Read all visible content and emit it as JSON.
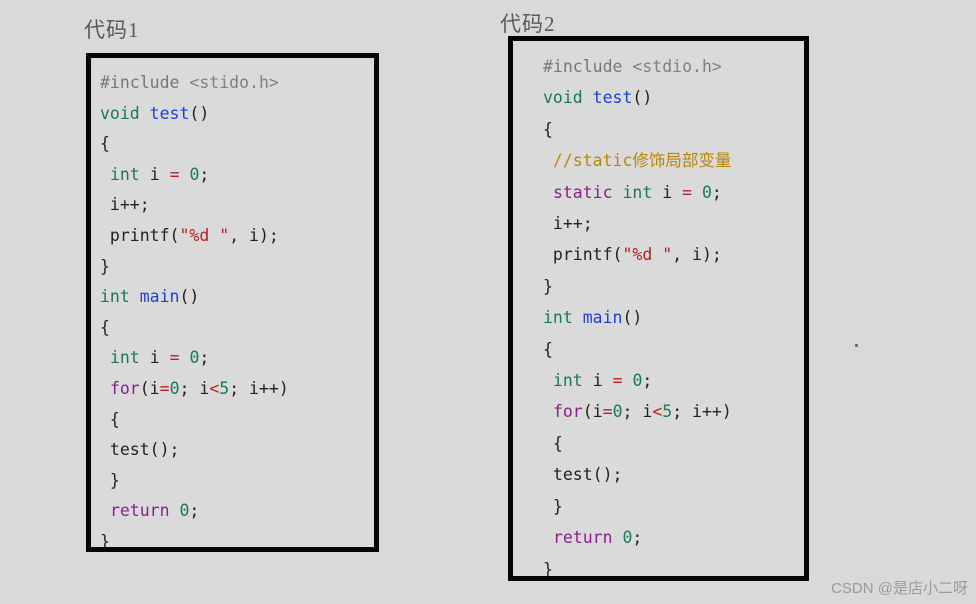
{
  "background_color": "#d9d9d9",
  "panels": [
    {
      "title": "代码1",
      "box_background": "#dadada",
      "border_color": "#060606",
      "lines": [
        [
          {
            "t": "#include ",
            "c": "tok-pre"
          },
          {
            "t": "<stido.h>",
            "c": "tok-header"
          }
        ],
        [
          {
            "t": "void ",
            "c": "tok-type"
          },
          {
            "t": "test",
            "c": "tok-fn"
          },
          {
            "t": "()",
            "c": "tok-plain"
          }
        ],
        [
          {
            "t": "{",
            "c": "tok-plain"
          }
        ],
        [
          {
            "t": " ",
            "c": "tok-plain"
          },
          {
            "t": "int ",
            "c": "tok-type"
          },
          {
            "t": "i ",
            "c": "tok-plain"
          },
          {
            "t": "=",
            "c": "tok-op"
          },
          {
            "t": " ",
            "c": "tok-plain"
          },
          {
            "t": "0",
            "c": "tok-num"
          },
          {
            "t": ";",
            "c": "tok-plain"
          }
        ],
        [
          {
            "t": " i++;",
            "c": "tok-plain"
          }
        ],
        [
          {
            "t": " printf(",
            "c": "tok-plain"
          },
          {
            "t": "\"%d \"",
            "c": "tok-str"
          },
          {
            "t": ", i);",
            "c": "tok-plain"
          }
        ],
        [
          {
            "t": "}",
            "c": "tok-plain"
          }
        ],
        [
          {
            "t": "int ",
            "c": "tok-type"
          },
          {
            "t": "main",
            "c": "tok-fn"
          },
          {
            "t": "()",
            "c": "tok-plain"
          }
        ],
        [
          {
            "t": "{",
            "c": "tok-plain"
          }
        ],
        [
          {
            "t": " ",
            "c": "tok-plain"
          },
          {
            "t": "int ",
            "c": "tok-type"
          },
          {
            "t": "i ",
            "c": "tok-plain"
          },
          {
            "t": "=",
            "c": "tok-op"
          },
          {
            "t": " ",
            "c": "tok-plain"
          },
          {
            "t": "0",
            "c": "tok-num"
          },
          {
            "t": ";",
            "c": "tok-plain"
          }
        ],
        [
          {
            "t": " ",
            "c": "tok-plain"
          },
          {
            "t": "for",
            "c": "tok-kw"
          },
          {
            "t": "(i",
            "c": "tok-plain"
          },
          {
            "t": "=",
            "c": "tok-op"
          },
          {
            "t": "0",
            "c": "tok-num"
          },
          {
            "t": "; i",
            "c": "tok-plain"
          },
          {
            "t": "<",
            "c": "tok-op"
          },
          {
            "t": "5",
            "c": "tok-num"
          },
          {
            "t": "; i++)",
            "c": "tok-plain"
          }
        ],
        [
          {
            "t": " {",
            "c": "tok-plain"
          }
        ],
        [
          {
            "t": " test();",
            "c": "tok-plain"
          }
        ],
        [
          {
            "t": " }",
            "c": "tok-plain"
          }
        ],
        [
          {
            "t": " ",
            "c": "tok-plain"
          },
          {
            "t": "return",
            "c": "tok-kw"
          },
          {
            "t": " ",
            "c": "tok-plain"
          },
          {
            "t": "0",
            "c": "tok-num"
          },
          {
            "t": ";",
            "c": "tok-plain"
          }
        ],
        [
          {
            "t": "}",
            "c": "tok-plain"
          }
        ]
      ]
    },
    {
      "title": "代码2",
      "box_background": "#dadada",
      "border_color": "#060606",
      "lines": [
        [
          {
            "t": "#include ",
            "c": "tok-pre"
          },
          {
            "t": "<stdio.h>",
            "c": "tok-header"
          }
        ],
        [
          {
            "t": "void ",
            "c": "tok-type"
          },
          {
            "t": "test",
            "c": "tok-fn"
          },
          {
            "t": "()",
            "c": "tok-plain"
          }
        ],
        [
          {
            "t": "{",
            "c": "tok-plain"
          }
        ],
        [
          {
            "t": " //static修饰局部变量",
            "c": "tok-comment"
          }
        ],
        [
          {
            "t": " ",
            "c": "tok-plain"
          },
          {
            "t": "static ",
            "c": "tok-kw"
          },
          {
            "t": "int ",
            "c": "tok-type"
          },
          {
            "t": "i ",
            "c": "tok-plain"
          },
          {
            "t": "=",
            "c": "tok-op"
          },
          {
            "t": " ",
            "c": "tok-plain"
          },
          {
            "t": "0",
            "c": "tok-num"
          },
          {
            "t": ";",
            "c": "tok-plain"
          }
        ],
        [
          {
            "t": " i++;",
            "c": "tok-plain"
          }
        ],
        [
          {
            "t": " printf(",
            "c": "tok-plain"
          },
          {
            "t": "\"%d \"",
            "c": "tok-str"
          },
          {
            "t": ", i);",
            "c": "tok-plain"
          }
        ],
        [
          {
            "t": "}",
            "c": "tok-plain"
          }
        ],
        [
          {
            "t": "int ",
            "c": "tok-type"
          },
          {
            "t": "main",
            "c": "tok-fn"
          },
          {
            "t": "()",
            "c": "tok-plain"
          }
        ],
        [
          {
            "t": "{",
            "c": "tok-plain"
          }
        ],
        [
          {
            "t": " ",
            "c": "tok-plain"
          },
          {
            "t": "int ",
            "c": "tok-type"
          },
          {
            "t": "i ",
            "c": "tok-plain"
          },
          {
            "t": "=",
            "c": "tok-op"
          },
          {
            "t": " ",
            "c": "tok-plain"
          },
          {
            "t": "0",
            "c": "tok-num"
          },
          {
            "t": ";",
            "c": "tok-plain"
          }
        ],
        [
          {
            "t": " ",
            "c": "tok-plain"
          },
          {
            "t": "for",
            "c": "tok-kw"
          },
          {
            "t": "(i",
            "c": "tok-plain"
          },
          {
            "t": "=",
            "c": "tok-op"
          },
          {
            "t": "0",
            "c": "tok-num"
          },
          {
            "t": "; i",
            "c": "tok-plain"
          },
          {
            "t": "<",
            "c": "tok-op"
          },
          {
            "t": "5",
            "c": "tok-num"
          },
          {
            "t": "; i++)",
            "c": "tok-plain"
          }
        ],
        [
          {
            "t": " {",
            "c": "tok-plain"
          }
        ],
        [
          {
            "t": " test();",
            "c": "tok-plain"
          }
        ],
        [
          {
            "t": " }",
            "c": "tok-plain"
          }
        ],
        [
          {
            "t": " ",
            "c": "tok-plain"
          },
          {
            "t": "return",
            "c": "tok-kw"
          },
          {
            "t": " ",
            "c": "tok-plain"
          },
          {
            "t": "0",
            "c": "tok-num"
          },
          {
            "t": ";",
            "c": "tok-plain"
          }
        ],
        [
          {
            "t": "}",
            "c": "tok-plain"
          }
        ]
      ]
    }
  ],
  "watermark": {
    "text": "CSDN @是店小二呀",
    "color": "#9a9a9a"
  }
}
